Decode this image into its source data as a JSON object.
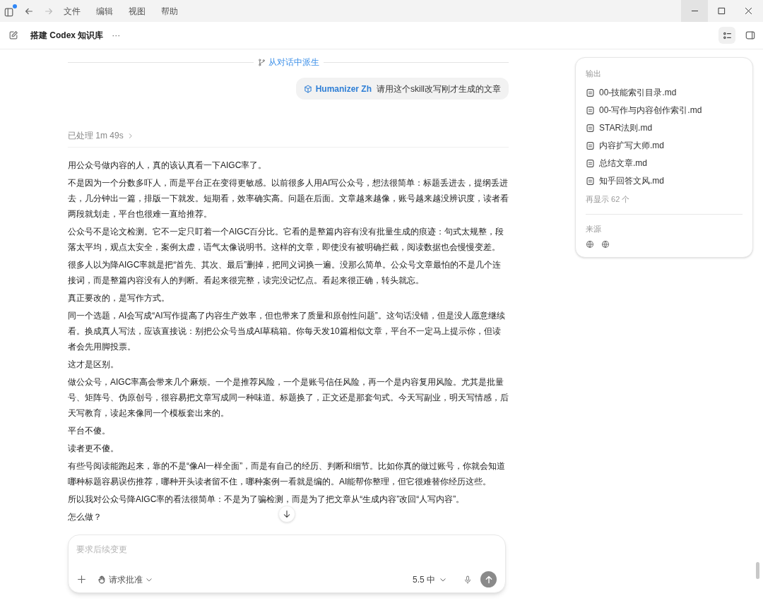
{
  "menu": [
    "文件",
    "编辑",
    "视图",
    "帮助"
  ],
  "header": {
    "title": "搭建 Codex 知识库",
    "more": "···"
  },
  "branch_label": "从对话中派生",
  "user_message": {
    "skill": "Humanizer Zh",
    "text": "请用这个skill改写刚才生成的文章"
  },
  "processed": "已处理 1m 49s",
  "paragraphs": [
    "用公众号做内容的人，真的该认真看一下AIGC率了。",
    "不是因为一个分数多吓人，而是平台正在变得更敏感。以前很多人用AI写公众号，想法很简单：标题丢进去，提纲丢进去，几分钟出一篇，排版一下就发。短期看，效率确实高。问题在后面。文章越来越像，账号越来越没辨识度，读者看两段就划走，平台也很难一直给推荐。",
    "公众号不是论文检测。它不一定只盯着一个AIGC百分比。它看的是整篇内容有没有批量生成的痕迹：句式太规整，段落太平均，观点太安全，案例太虚，语气太像说明书。这样的文章，即使没有被明确拦截，阅读数据也会慢慢变差。",
    "很多人以为降AIGC率就是把“首先、其次、最后”删掉，把同义词换一遍。没那么简单。公众号文章最怕的不是几个连接词，而是整篇内容没有人的判断。看起来很完整，读完没记忆点。看起来很正确，转头就忘。",
    "真正要改的，是写作方式。",
    "同一个选题，AI会写成“AI写作提高了内容生产效率，但也带来了质量和原创性问题”。这句话没错，但是没人愿意继续看。换成真人写法，应该直接说：别把公众号当成AI草稿箱。你每天发10篇相似文章，平台不一定马上提示你，但读者会先用脚投票。",
    "这才是区别。",
    "做公众号，AIGC率高会带来几个麻烦。一个是推荐风险，一个是账号信任风险，再一个是内容复用风险。尤其是批量号、矩阵号、伪原创号，很容易把文章写成同一种味道。标题换了，正文还是那套句式。今天写副业，明天写情感，后天写教育，读起来像同一个模板套出来的。",
    "平台不傻。",
    "读者更不傻。",
    "有些号阅读能跑起来，靠的不是“像AI一样全面”，而是有自己的经历、判断和细节。比如你真的做过账号，你就会知道哪种标题容易误伤推荐，哪种开头读者留不住，哪种案例一看就是编的。AI能帮你整理，但它很难替你经历这些。",
    "所以我对公众号降AIGC率的看法很简单：不是为了骗检测，而是为了把文章从“生成内容”改回“人写内容”。",
    "怎么做？"
  ],
  "composer": {
    "placeholder": "要求后续变更",
    "permission": "请求批准",
    "model": "5.5",
    "effort": "中"
  },
  "panel": {
    "outputs_title": "输出",
    "files": [
      "00-技能索引目录.md",
      "00-写作与内容创作索引.md",
      "STAR法则.md",
      "内容扩写大师.md",
      "总结文章.md",
      "知乎回答文风.md"
    ],
    "more": "再显示 62 个",
    "sources_title": "来源"
  }
}
